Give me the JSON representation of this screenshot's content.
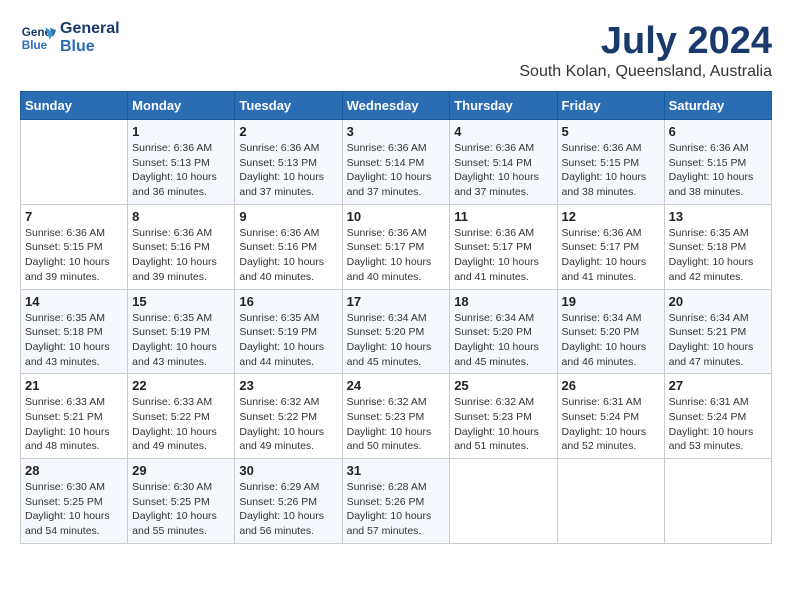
{
  "header": {
    "logo_line1": "General",
    "logo_line2": "Blue",
    "month": "July 2024",
    "location": "South Kolan, Queensland, Australia"
  },
  "weekdays": [
    "Sunday",
    "Monday",
    "Tuesday",
    "Wednesday",
    "Thursday",
    "Friday",
    "Saturday"
  ],
  "weeks": [
    [
      {
        "day": "",
        "sunrise": "",
        "sunset": "",
        "daylight": ""
      },
      {
        "day": "1",
        "sunrise": "Sunrise: 6:36 AM",
        "sunset": "Sunset: 5:13 PM",
        "daylight": "Daylight: 10 hours and 36 minutes."
      },
      {
        "day": "2",
        "sunrise": "Sunrise: 6:36 AM",
        "sunset": "Sunset: 5:13 PM",
        "daylight": "Daylight: 10 hours and 37 minutes."
      },
      {
        "day": "3",
        "sunrise": "Sunrise: 6:36 AM",
        "sunset": "Sunset: 5:14 PM",
        "daylight": "Daylight: 10 hours and 37 minutes."
      },
      {
        "day": "4",
        "sunrise": "Sunrise: 6:36 AM",
        "sunset": "Sunset: 5:14 PM",
        "daylight": "Daylight: 10 hours and 37 minutes."
      },
      {
        "day": "5",
        "sunrise": "Sunrise: 6:36 AM",
        "sunset": "Sunset: 5:15 PM",
        "daylight": "Daylight: 10 hours and 38 minutes."
      },
      {
        "day": "6",
        "sunrise": "Sunrise: 6:36 AM",
        "sunset": "Sunset: 5:15 PM",
        "daylight": "Daylight: 10 hours and 38 minutes."
      }
    ],
    [
      {
        "day": "7",
        "sunrise": "Sunrise: 6:36 AM",
        "sunset": "Sunset: 5:15 PM",
        "daylight": "Daylight: 10 hours and 39 minutes."
      },
      {
        "day": "8",
        "sunrise": "Sunrise: 6:36 AM",
        "sunset": "Sunset: 5:16 PM",
        "daylight": "Daylight: 10 hours and 39 minutes."
      },
      {
        "day": "9",
        "sunrise": "Sunrise: 6:36 AM",
        "sunset": "Sunset: 5:16 PM",
        "daylight": "Daylight: 10 hours and 40 minutes."
      },
      {
        "day": "10",
        "sunrise": "Sunrise: 6:36 AM",
        "sunset": "Sunset: 5:17 PM",
        "daylight": "Daylight: 10 hours and 40 minutes."
      },
      {
        "day": "11",
        "sunrise": "Sunrise: 6:36 AM",
        "sunset": "Sunset: 5:17 PM",
        "daylight": "Daylight: 10 hours and 41 minutes."
      },
      {
        "day": "12",
        "sunrise": "Sunrise: 6:36 AM",
        "sunset": "Sunset: 5:17 PM",
        "daylight": "Daylight: 10 hours and 41 minutes."
      },
      {
        "day": "13",
        "sunrise": "Sunrise: 6:35 AM",
        "sunset": "Sunset: 5:18 PM",
        "daylight": "Daylight: 10 hours and 42 minutes."
      }
    ],
    [
      {
        "day": "14",
        "sunrise": "Sunrise: 6:35 AM",
        "sunset": "Sunset: 5:18 PM",
        "daylight": "Daylight: 10 hours and 43 minutes."
      },
      {
        "day": "15",
        "sunrise": "Sunrise: 6:35 AM",
        "sunset": "Sunset: 5:19 PM",
        "daylight": "Daylight: 10 hours and 43 minutes."
      },
      {
        "day": "16",
        "sunrise": "Sunrise: 6:35 AM",
        "sunset": "Sunset: 5:19 PM",
        "daylight": "Daylight: 10 hours and 44 minutes."
      },
      {
        "day": "17",
        "sunrise": "Sunrise: 6:34 AM",
        "sunset": "Sunset: 5:20 PM",
        "daylight": "Daylight: 10 hours and 45 minutes."
      },
      {
        "day": "18",
        "sunrise": "Sunrise: 6:34 AM",
        "sunset": "Sunset: 5:20 PM",
        "daylight": "Daylight: 10 hours and 45 minutes."
      },
      {
        "day": "19",
        "sunrise": "Sunrise: 6:34 AM",
        "sunset": "Sunset: 5:20 PM",
        "daylight": "Daylight: 10 hours and 46 minutes."
      },
      {
        "day": "20",
        "sunrise": "Sunrise: 6:34 AM",
        "sunset": "Sunset: 5:21 PM",
        "daylight": "Daylight: 10 hours and 47 minutes."
      }
    ],
    [
      {
        "day": "21",
        "sunrise": "Sunrise: 6:33 AM",
        "sunset": "Sunset: 5:21 PM",
        "daylight": "Daylight: 10 hours and 48 minutes."
      },
      {
        "day": "22",
        "sunrise": "Sunrise: 6:33 AM",
        "sunset": "Sunset: 5:22 PM",
        "daylight": "Daylight: 10 hours and 49 minutes."
      },
      {
        "day": "23",
        "sunrise": "Sunrise: 6:32 AM",
        "sunset": "Sunset: 5:22 PM",
        "daylight": "Daylight: 10 hours and 49 minutes."
      },
      {
        "day": "24",
        "sunrise": "Sunrise: 6:32 AM",
        "sunset": "Sunset: 5:23 PM",
        "daylight": "Daylight: 10 hours and 50 minutes."
      },
      {
        "day": "25",
        "sunrise": "Sunrise: 6:32 AM",
        "sunset": "Sunset: 5:23 PM",
        "daylight": "Daylight: 10 hours and 51 minutes."
      },
      {
        "day": "26",
        "sunrise": "Sunrise: 6:31 AM",
        "sunset": "Sunset: 5:24 PM",
        "daylight": "Daylight: 10 hours and 52 minutes."
      },
      {
        "day": "27",
        "sunrise": "Sunrise: 6:31 AM",
        "sunset": "Sunset: 5:24 PM",
        "daylight": "Daylight: 10 hours and 53 minutes."
      }
    ],
    [
      {
        "day": "28",
        "sunrise": "Sunrise: 6:30 AM",
        "sunset": "Sunset: 5:25 PM",
        "daylight": "Daylight: 10 hours and 54 minutes."
      },
      {
        "day": "29",
        "sunrise": "Sunrise: 6:30 AM",
        "sunset": "Sunset: 5:25 PM",
        "daylight": "Daylight: 10 hours and 55 minutes."
      },
      {
        "day": "30",
        "sunrise": "Sunrise: 6:29 AM",
        "sunset": "Sunset: 5:26 PM",
        "daylight": "Daylight: 10 hours and 56 minutes."
      },
      {
        "day": "31",
        "sunrise": "Sunrise: 6:28 AM",
        "sunset": "Sunset: 5:26 PM",
        "daylight": "Daylight: 10 hours and 57 minutes."
      },
      {
        "day": "",
        "sunrise": "",
        "sunset": "",
        "daylight": ""
      },
      {
        "day": "",
        "sunrise": "",
        "sunset": "",
        "daylight": ""
      },
      {
        "day": "",
        "sunrise": "",
        "sunset": "",
        "daylight": ""
      }
    ]
  ]
}
